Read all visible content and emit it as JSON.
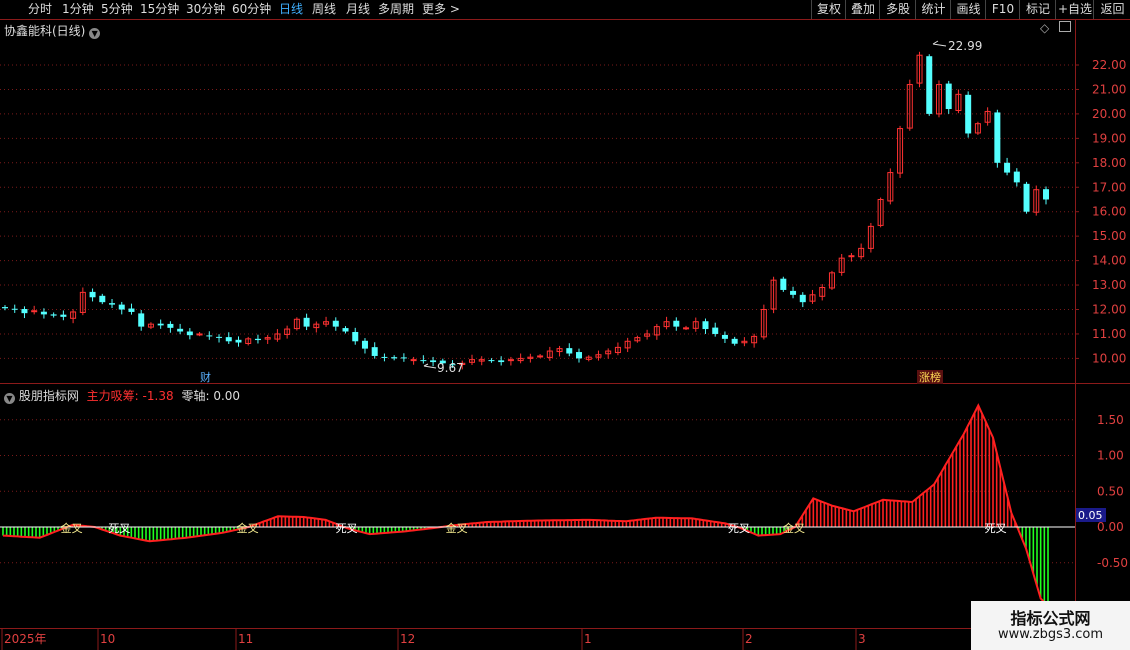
{
  "toolbar": {
    "periods": [
      "分时",
      "1分钟",
      "5分钟",
      "15分钟",
      "30分钟",
      "60分钟",
      "日线",
      "周线",
      "月线",
      "多周期",
      "更多 >"
    ],
    "active_period": "日线",
    "right_buttons": [
      "复权",
      "叠加",
      "多股",
      "统计",
      "画线",
      "F10",
      "标记",
      "+自选",
      "返回"
    ]
  },
  "main_chart": {
    "title": "协鑫能科(日线)",
    "high_label": "22.99",
    "low_label": "9.67",
    "badge_cai": "财",
    "badge_zhangbang": "涨榜",
    "price_ticks": [
      "22.00",
      "21.00",
      "20.00",
      "19.00",
      "18.00",
      "17.00",
      "16.00",
      "15.00",
      "14.00",
      "13.00",
      "12.00",
      "11.00",
      "10.00"
    ]
  },
  "indicator": {
    "name": "股朋指标网",
    "line1_label": "主力吸筹:",
    "line1_value": "-1.38",
    "line2_label": "零轴:",
    "line2_value": "0.00",
    "current_value": "0.05",
    "ticks": [
      "1.50",
      "1.00",
      "0.50",
      "0.00",
      "-0.50"
    ],
    "signals": [
      {
        "text": "金叉",
        "bar": 19,
        "color": "#f0e68c"
      },
      {
        "text": "死叉",
        "bar": 32,
        "color": "#ffffff"
      },
      {
        "text": "金叉",
        "bar": 67,
        "color": "#f0e68c"
      },
      {
        "text": "死叉",
        "bar": 94,
        "color": "#ffffff"
      },
      {
        "text": "金叉",
        "bar": 124,
        "color": "#f0e68c"
      },
      {
        "text": "死叉",
        "bar": 201,
        "color": "#ffffff"
      },
      {
        "text": "金叉",
        "bar": 216,
        "color": "#f0e68c"
      },
      {
        "text": "死叉",
        "bar": 271,
        "color": "#ffffff"
      }
    ]
  },
  "date_axis": {
    "labels": [
      "2025年",
      "10",
      "11",
      "12",
      "1",
      "2",
      "3"
    ]
  },
  "watermark": {
    "line1": "指标公式网",
    "line2": "www.zbgs3.com"
  },
  "chart_data": {
    "type": "candlestick",
    "note_values": "closing price per trading day (yuan), read approximately from the chart",
    "closes": [
      12.05,
      12.0,
      11.85,
      11.95,
      11.8,
      11.75,
      11.7,
      11.9,
      12.7,
      12.5,
      12.3,
      12.2,
      12.0,
      11.9,
      11.3,
      11.4,
      11.35,
      11.25,
      11.1,
      10.95,
      11.0,
      10.9,
      10.85,
      10.7,
      10.65,
      10.8,
      10.75,
      10.85,
      11.0,
      11.2,
      11.6,
      11.3,
      11.4,
      11.5,
      11.3,
      11.1,
      10.7,
      10.4,
      10.1,
      10.05,
      10.0,
      10.0,
      9.95,
      9.9,
      9.85,
      9.8,
      9.75,
      9.8,
      9.95,
      9.95,
      9.9,
      9.85,
      9.95,
      10.0,
      10.05,
      10.1,
      10.3,
      10.4,
      10.2,
      10.0,
      10.05,
      10.15,
      10.3,
      10.45,
      10.7,
      10.85,
      11.0,
      11.3,
      11.5,
      11.3,
      11.25,
      11.5,
      11.2,
      11.0,
      10.8,
      10.6,
      10.7,
      10.9,
      12.0,
      13.2,
      12.8,
      12.6,
      12.3,
      12.6,
      12.9,
      13.5,
      14.1,
      14.2,
      14.5,
      15.4,
      16.5,
      17.6,
      19.4,
      21.2,
      22.4,
      20.0,
      21.2,
      20.2,
      20.8,
      19.2,
      19.6,
      20.1,
      18.0,
      17.6,
      17.2,
      16.0,
      16.9,
      16.5
    ],
    "ylim": [
      9.5,
      23.1
    ],
    "indicator": {
      "zero_axis": 0.0,
      "ylim": [
        -1.05,
        1.95
      ]
    }
  }
}
